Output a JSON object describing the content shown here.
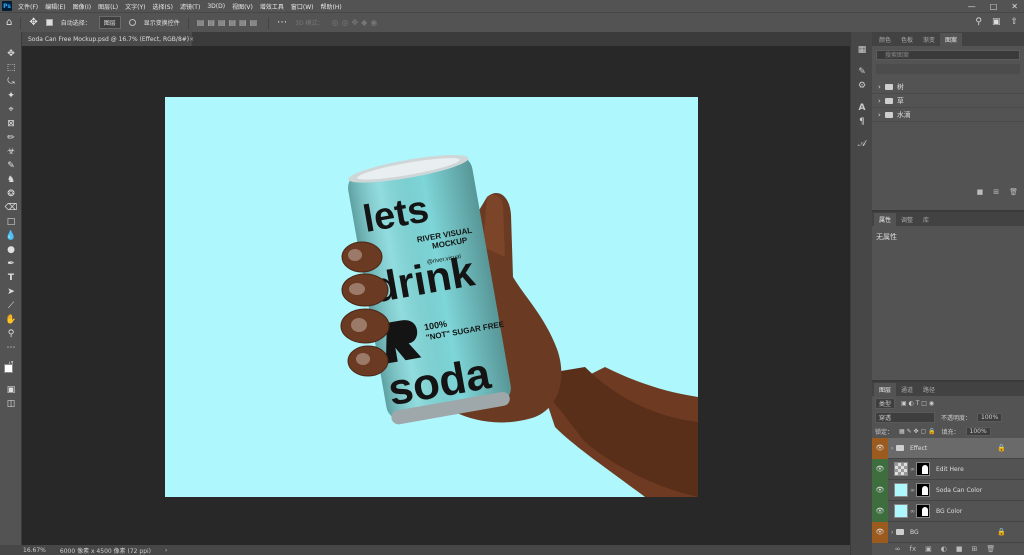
{
  "app": {
    "logo": "Ps"
  },
  "menu": [
    "文件(F)",
    "编辑(E)",
    "图像(I)",
    "图层(L)",
    "文字(Y)",
    "选择(S)",
    "滤镜(T)",
    "3D(D)",
    "视图(V)",
    "增效工具",
    "窗口(W)",
    "帮助(H)"
  ],
  "options": {
    "auto_select_label": "自动选择：",
    "auto_select_value": "图层",
    "show_transform_label": "显示变换控件",
    "mode_3d_label": "3D 模式："
  },
  "document": {
    "tab_title": "Soda Can Free Mockup.psd @ 16.7% (Effect, RGB/8#)",
    "canvas_bg": "#aef7fd"
  },
  "can": {
    "line1": "lets",
    "line2": "drink",
    "line3": "soda",
    "brand": "RIVER VISUAL\nMOCKUP",
    "handle": "@river.visual",
    "tagline": "100%\n\"NOT\" SUGAR FREE",
    "color": "#7ed6d8"
  },
  "status": {
    "zoom": "16.67%",
    "dims": "6000 像素 x 4500 像素 (72 ppi)"
  },
  "libraries_panel": {
    "tabs": [
      "颜色",
      "色板",
      "渐变",
      "图案"
    ],
    "search_placeholder": "搜索图案",
    "groups": [
      "树",
      "草",
      "水滴"
    ]
  },
  "properties_panel": {
    "tabs": [
      "属性",
      "调整",
      "库"
    ],
    "content": "无属性"
  },
  "layers_panel": {
    "tabs": [
      "图层",
      "通道",
      "路径"
    ],
    "kind_label": "类型",
    "mode": "穿透",
    "opacity_label": "不透明度：",
    "opacity_value": "100%",
    "lock_label": "锁定：",
    "fill_label": "填充：",
    "fill_value": "100%",
    "layers": [
      {
        "name": "Effect",
        "type": "group"
      },
      {
        "name": "Edit Here",
        "type": "smart"
      },
      {
        "name": "Soda Can Color",
        "type": "fill"
      },
      {
        "name": "BG Color",
        "type": "fill"
      },
      {
        "name": "BG",
        "type": "group"
      }
    ]
  }
}
